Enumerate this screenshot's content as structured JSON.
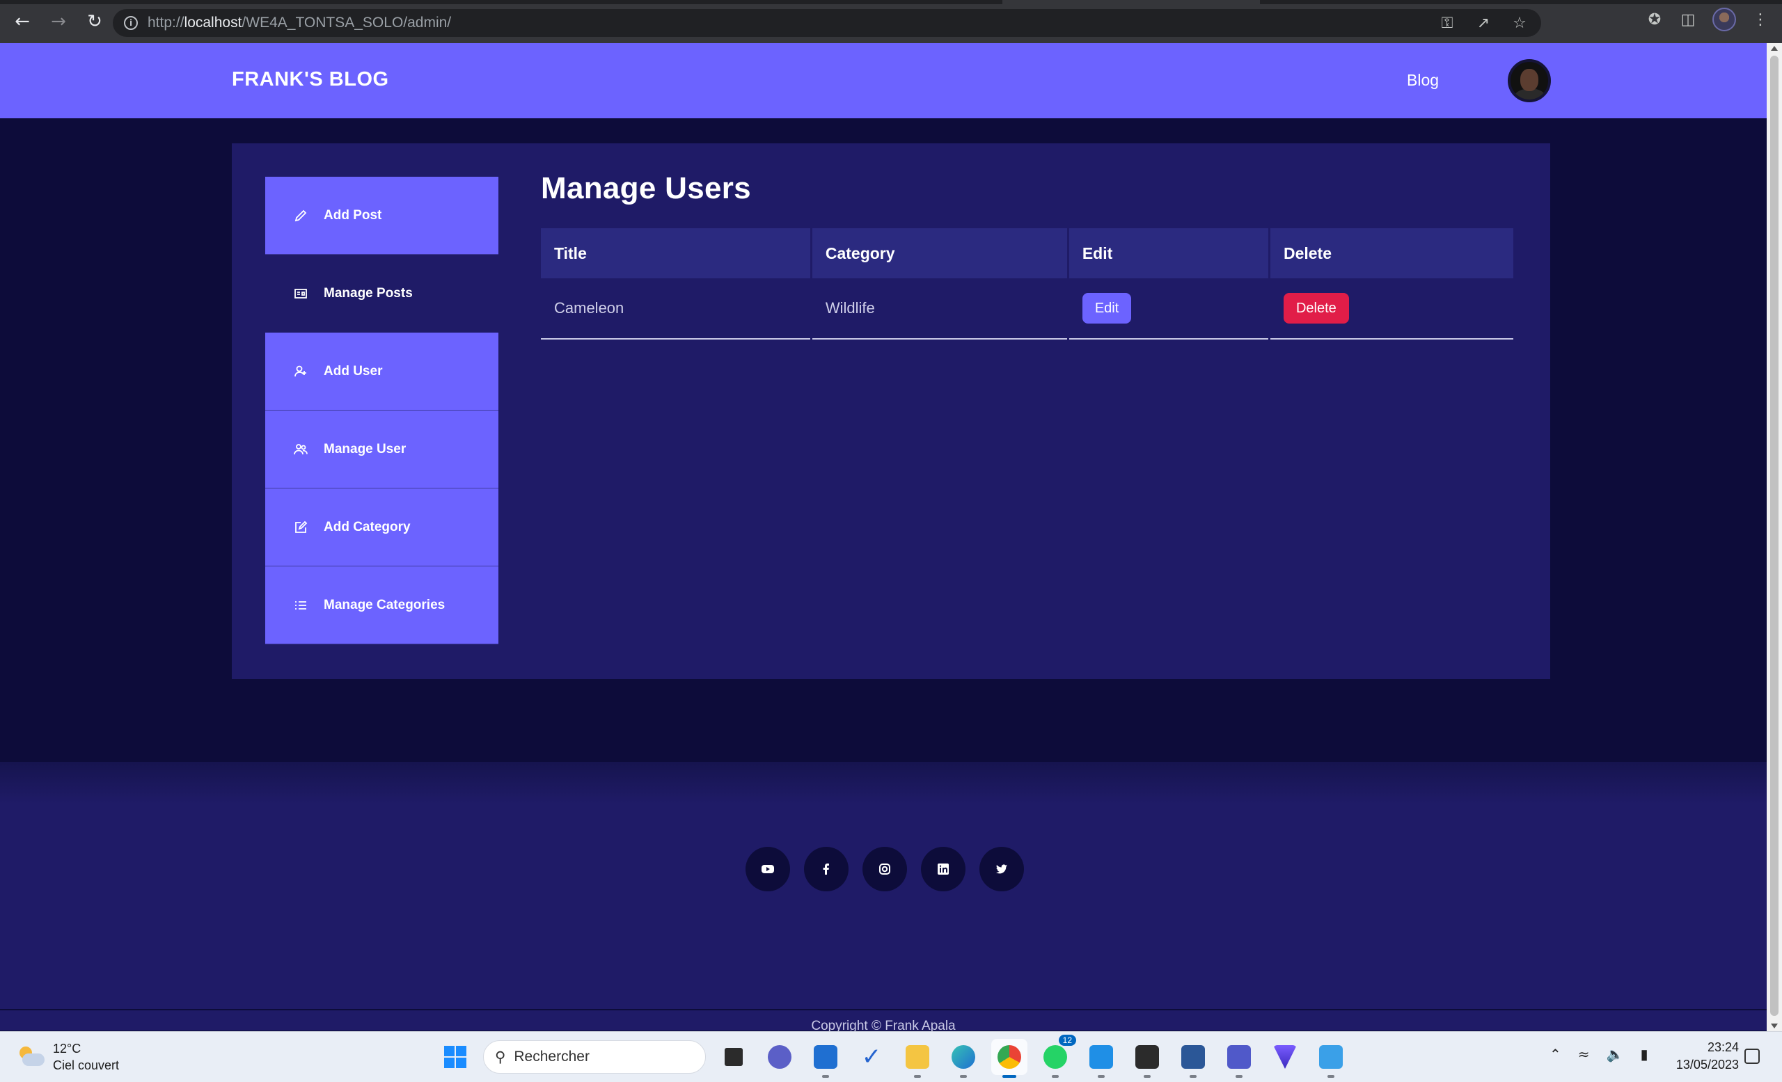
{
  "browser": {
    "url_prefix": "http://",
    "url_host": "localhost",
    "url_path": "/WE4A_TONTSA_SOLO/admin/"
  },
  "header": {
    "brand": "FRANK'S BLOG",
    "nav_blog": "Blog"
  },
  "sidebar": {
    "items": [
      {
        "label": "Add Post",
        "icon": "pencil-icon"
      },
      {
        "label": "Manage Posts",
        "icon": "posts-icon"
      },
      {
        "label": "Add User",
        "icon": "user-add-icon"
      },
      {
        "label": "Manage User",
        "icon": "users-icon"
      },
      {
        "label": "Add Category",
        "icon": "edit-square-icon"
      },
      {
        "label": "Manage Categories",
        "icon": "list-icon"
      }
    ],
    "active_index": 1
  },
  "main": {
    "title": "Manage Users",
    "table": {
      "headers": [
        "Title",
        "Category",
        "Edit",
        "Delete"
      ],
      "rows": [
        {
          "title": "Cameleon",
          "category": "Wildlife",
          "edit": "Edit",
          "delete": "Delete"
        }
      ]
    }
  },
  "footer": {
    "socials": [
      "youtube-icon",
      "facebook-icon",
      "instagram-icon",
      "linkedin-icon",
      "twitter-icon"
    ],
    "copyright": "Copyright © Frank Apala"
  },
  "taskbar": {
    "weather_temp": "12°C",
    "weather_desc": "Ciel couvert",
    "search_placeholder": "Rechercher",
    "whatsapp_badge": "12",
    "time": "23:24",
    "date": "13/05/2023"
  },
  "colors": {
    "accent": "#6c63ff",
    "panel": "#1f1b67",
    "background": "#0d0c3a",
    "delete": "#e11d48"
  }
}
